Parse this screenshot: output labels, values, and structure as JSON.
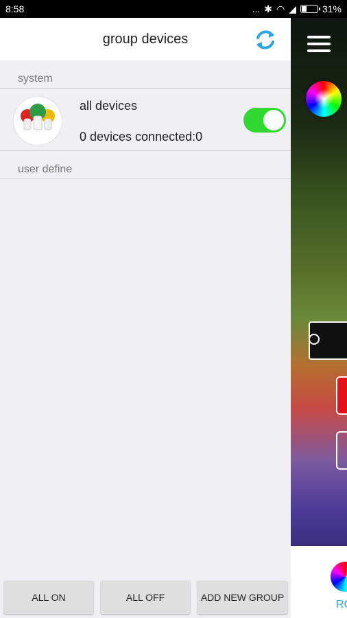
{
  "status_bar": {
    "time": "8:58",
    "dots": "...",
    "battery": "31%"
  },
  "drawer": {
    "header_title": "group devices",
    "sections": {
      "system": "system",
      "user_define": "user define"
    },
    "device_row": {
      "title": "all devices",
      "subtitle": "0 devices connected:0",
      "toggle_on": true
    },
    "buttons": {
      "all_on": "ALL ON",
      "all_off": "ALL OFF",
      "add_new_group": "ADD NEW GROUP"
    }
  },
  "background_app": {
    "tab_label_partial": "RG"
  },
  "colors": {
    "accent_blue": "#2aa7e8",
    "toggle_green": "#2fd92f",
    "drawer_bg": "#efeff4"
  }
}
